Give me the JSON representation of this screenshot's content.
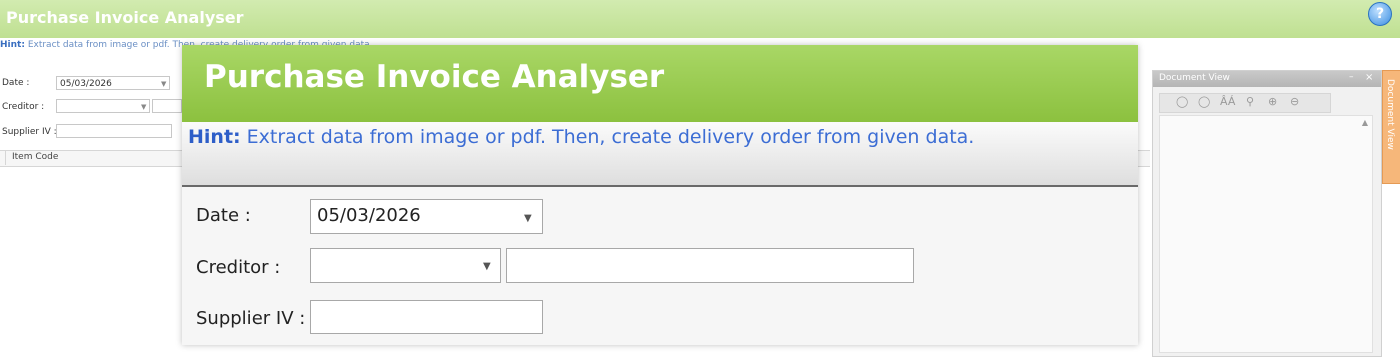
{
  "app": {
    "title": "Purchase Invoice Analyser",
    "help_icon": "?"
  },
  "hint": {
    "label": "Hint:",
    "text": "Extract data from image or pdf. Then, create delivery order from given data."
  },
  "form": {
    "date_label": "Date :",
    "date_value": "05/03/2026",
    "creditor_label": "Creditor :",
    "creditor_value": "",
    "creditor_name_value": "",
    "supplier_iv_label": "Supplier IV :",
    "supplier_iv_value": ""
  },
  "grid": {
    "columns": [
      "Item Code"
    ]
  },
  "document_view": {
    "title": "Document View",
    "tab_label": "Document View",
    "toolbar_icons": [
      "rotate-left-icon",
      "rotate-right-icon",
      "find-icon",
      "zoom-icon",
      "zoom-in-icon",
      "zoom-out-icon"
    ]
  },
  "zoom_panel": {
    "title": "Purchase Invoice Analyser",
    "hint_label": "Hint:",
    "hint_text": "Extract data from image or pdf. Then, create delivery order from given data.",
    "date_label": "Date :",
    "date_value": "05/03/2026",
    "creditor_label": "Creditor :",
    "supplier_iv_label": "Supplier IV :"
  },
  "colors": {
    "header_green": "#8cc13f",
    "hint_blue": "#3c6dd4",
    "side_tab_orange": "#f6b77a"
  }
}
